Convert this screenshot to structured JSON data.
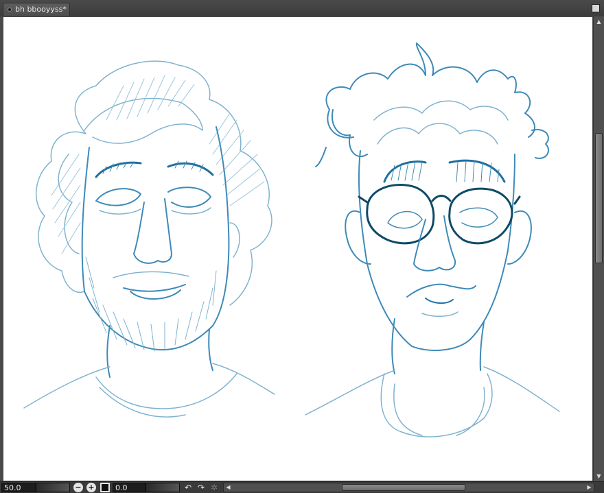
{
  "document": {
    "tab_title": "bh bbooyyss*"
  },
  "statusbar": {
    "zoom_value": "50.0",
    "rotation_value": "0.0",
    "zoom_out_icon": "zoom-out-icon",
    "zoom_in_icon": "zoom-in-icon",
    "fit_icon": "fit-screen-icon",
    "rotate_left_icon": "rotate-left-icon",
    "rotate_right_icon": "rotate-right-icon",
    "reset_rotation_icon": "reset-rotation-icon"
  },
  "colors": {
    "sketch_light": "#7fb3cf",
    "sketch_mid": "#3d8ab8",
    "sketch_dark": "#1f6f9f",
    "glasses": "#0e4a66",
    "canvas": "#ffffff",
    "chrome": "#3a3a3a"
  }
}
